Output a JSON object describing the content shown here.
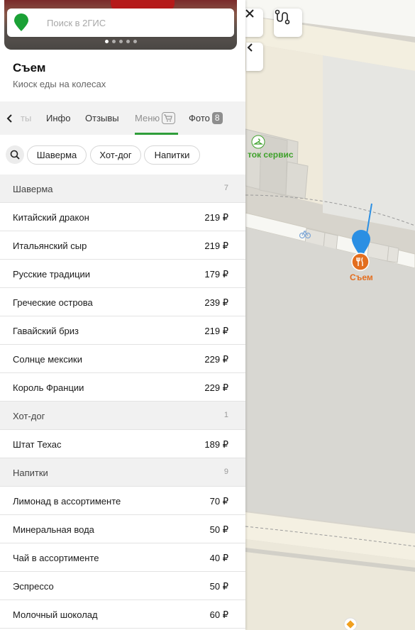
{
  "search": {
    "placeholder": "Поиск в 2ГИС"
  },
  "place": {
    "title": "Съем",
    "subtitle": "Киоск еды на колесах"
  },
  "tabs": {
    "faded_label": "ты",
    "info": "Инфо",
    "reviews": "Отзывы",
    "menu": "Меню",
    "photo": "Фото",
    "photo_count": "8"
  },
  "chips": [
    "Шаверма",
    "Хот-дог",
    "Напитки"
  ],
  "menu": [
    {
      "section": "Шаверма",
      "count": "7",
      "items": [
        {
          "name": "Китайский дракон",
          "price": "219 ₽"
        },
        {
          "name": "Итальянский сыр",
          "price": "219 ₽"
        },
        {
          "name": "Русские традиции",
          "price": "179 ₽"
        },
        {
          "name": "Греческие острова",
          "price": "239 ₽"
        },
        {
          "name": "Гавайский бриз",
          "price": "219 ₽"
        },
        {
          "name": "Солнце мексики",
          "price": "229 ₽"
        },
        {
          "name": "Король Франции",
          "price": "229 ₽"
        }
      ]
    },
    {
      "section": "Хот-дог",
      "count": "1",
      "items": [
        {
          "name": "Штат Техас",
          "price": "189 ₽"
        }
      ]
    },
    {
      "section": "Напитки",
      "count": "9",
      "items": [
        {
          "name": "Лимонад в ассортименте",
          "price": "70 ₽"
        },
        {
          "name": "Минеральная вода",
          "price": "50 ₽"
        },
        {
          "name": "Чай в ассортименте",
          "price": "40 ₽"
        },
        {
          "name": "Эспрессо",
          "price": "50 ₽"
        },
        {
          "name": "Молочный шоколад",
          "price": "60 ₽"
        }
      ]
    }
  ],
  "map": {
    "label_service": "ток сервис",
    "poi_label": "Съем"
  },
  "colors": {
    "accent_green": "#2f9e3a",
    "pin_blue": "#2b8fe3",
    "poi_orange": "#e36e1f"
  },
  "icons": [
    "search-icon",
    "close-icon",
    "route-icon",
    "chevron-left-icon",
    "cart-icon",
    "bicycle-icon",
    "hanger-icon",
    "map-pin-icon",
    "fork-knife-icon"
  ]
}
